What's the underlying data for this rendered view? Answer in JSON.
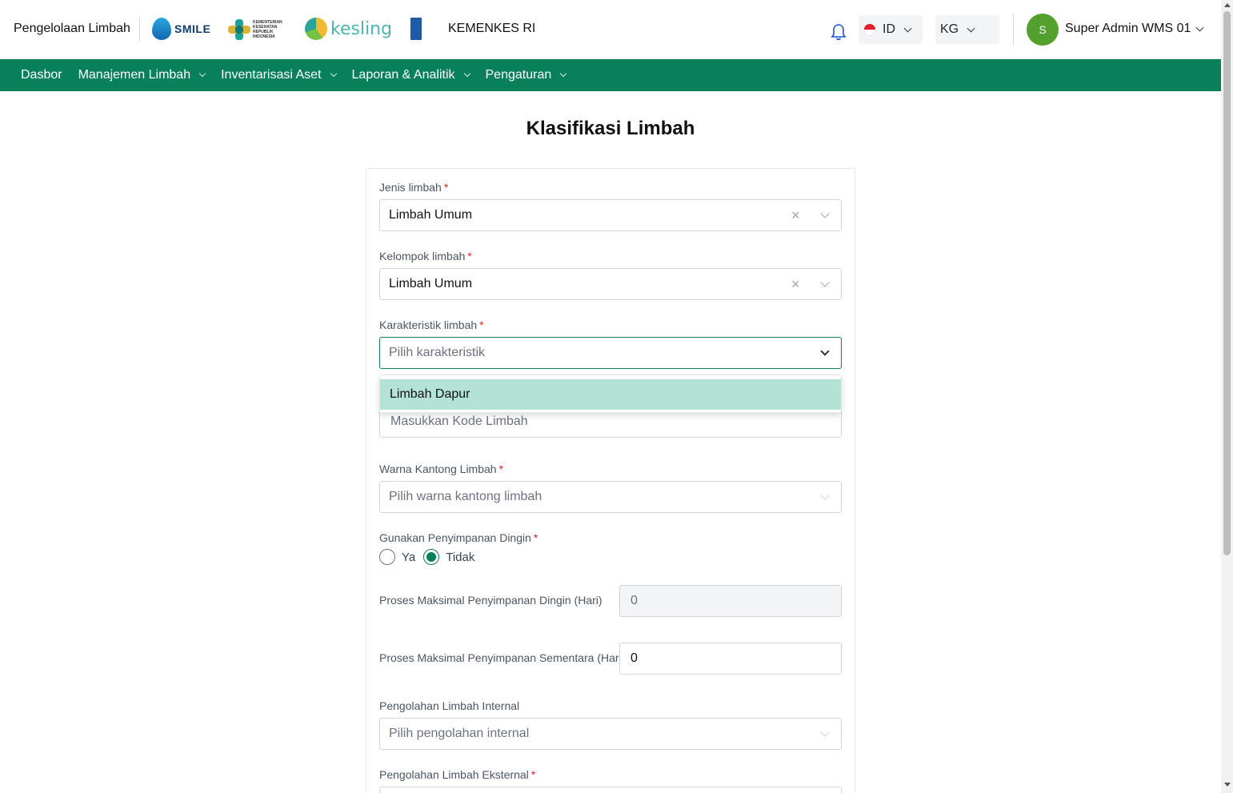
{
  "header": {
    "app_name": "Pengelolaan Limbah",
    "logos": [
      "SMILE",
      "KEMENTERIAN KESEHATAN REPUBLIK INDONESIA",
      "kesling",
      "UNDP"
    ],
    "smile_word": "SMILE",
    "kemenkes_small": "KEMENTERIAN KESEHATAN REPUBLIK INDONESIA",
    "kesling_word": "kesling",
    "org": "KEMENKES RI",
    "language": "ID",
    "unit": "KG",
    "avatar_initial": "S",
    "user_name": "Super Admin WMS 01"
  },
  "nav": {
    "items": [
      {
        "label": "Dasbor"
      },
      {
        "label": "Manajemen Limbah"
      },
      {
        "label": "Inventarisasi Aset"
      },
      {
        "label": "Laporan & Analitik"
      },
      {
        "label": "Pengaturan"
      }
    ]
  },
  "page": {
    "title": "Klasifikasi Limbah"
  },
  "form": {
    "required_mark": "*",
    "jenis": {
      "label": "Jenis limbah",
      "value": "Limbah Umum"
    },
    "kelompok": {
      "label": "Kelompok limbah",
      "value": "Limbah Umum"
    },
    "karakteristik": {
      "label": "Karakteristik limbah",
      "placeholder": "Pilih karakteristik",
      "options": [
        "Limbah Dapur"
      ]
    },
    "kode": {
      "placeholder": "Masukkan Kode Limbah"
    },
    "warna": {
      "label": "Warna Kantong Limbah",
      "placeholder": "Pilih warna kantong limbah"
    },
    "dingin": {
      "label": "Gunakan Penyimpanan Dingin",
      "options": [
        "Ya",
        "Tidak"
      ],
      "selected": "Tidak"
    },
    "proses_dingin": {
      "label": "Proses Maksimal Penyimpanan Dingin (Hari)",
      "value": "0"
    },
    "proses_sementara": {
      "label": "Proses Maksimal Penyimpanan Sementara (Hari)",
      "value": "0"
    },
    "internal": {
      "label": "Pengolahan Limbah Internal",
      "placeholder": "Pilih pengolahan internal"
    },
    "eksternal": {
      "label": "Pengolahan Limbah Eksternal"
    }
  },
  "colors": {
    "brand_green": "#08805a",
    "dropdown_highlight": "#b3e3d5",
    "avatar": "#53a02f",
    "required": "#dc2626"
  }
}
